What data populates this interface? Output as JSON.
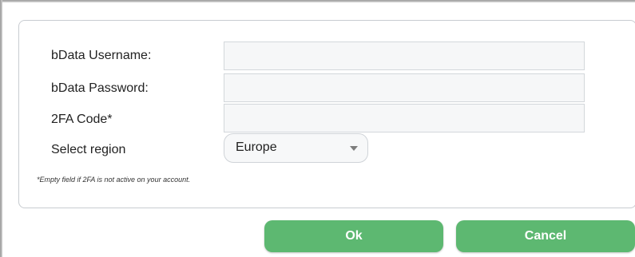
{
  "form": {
    "username_label": "bData Username:",
    "username_value": "",
    "password_label": "bData Password:",
    "password_value": "",
    "twofa_label": "2FA Code*",
    "twofa_value": "",
    "region_label": "Select region",
    "region_value": "Europe",
    "note": "*Empty field if 2FA is not active on your account."
  },
  "actions": {
    "ok_label": "Ok",
    "cancel_label": "Cancel"
  },
  "colors": {
    "button_green": "#5db871",
    "field_background": "#f6f7f8",
    "panel_border": "#c8ccd1"
  },
  "icons": {
    "region_dropdown": "caret-down-icon"
  }
}
